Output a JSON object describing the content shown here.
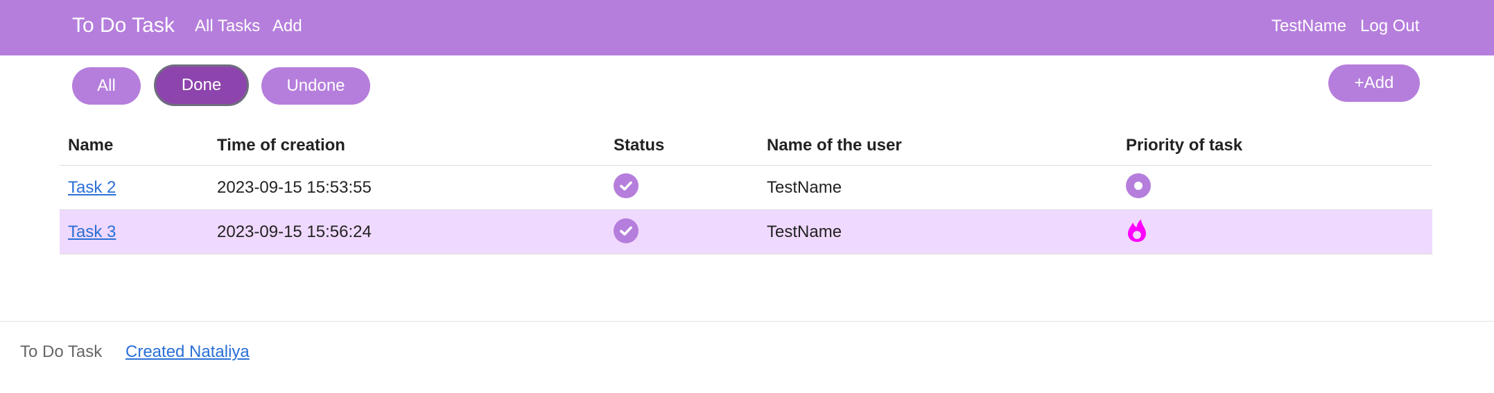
{
  "nav": {
    "brand": "To Do Task",
    "links": [
      "All Tasks",
      "Add"
    ],
    "user": "TestName",
    "logout": "Log Out"
  },
  "filters": [
    {
      "label": "All",
      "active": false
    },
    {
      "label": "Done",
      "active": true
    },
    {
      "label": "Undone",
      "active": false
    }
  ],
  "add_button": "+Add",
  "table": {
    "headers": [
      "Name",
      "Time of creation",
      "Status",
      "Name of the user",
      "Priority of task"
    ],
    "rows": [
      {
        "name": "Task 2",
        "created": "2023-09-15 15:53:55",
        "status": "check-icon",
        "user": "TestName",
        "priority": "normal-priority-icon",
        "highlighted": false
      },
      {
        "name": "Task 3",
        "created": "2023-09-15 15:56:24",
        "status": "check-icon",
        "user": "TestName",
        "priority": "fire-icon",
        "highlighted": true
      }
    ]
  },
  "footer": {
    "brand": "To Do Task",
    "link": "Created Nataliya"
  },
  "colors": {
    "accent": "#b57edc",
    "accent_active": "#8e44ad",
    "row_highlight": "#f0d9ff",
    "fire": "#ff00ff",
    "link": "#2a6fd6"
  }
}
